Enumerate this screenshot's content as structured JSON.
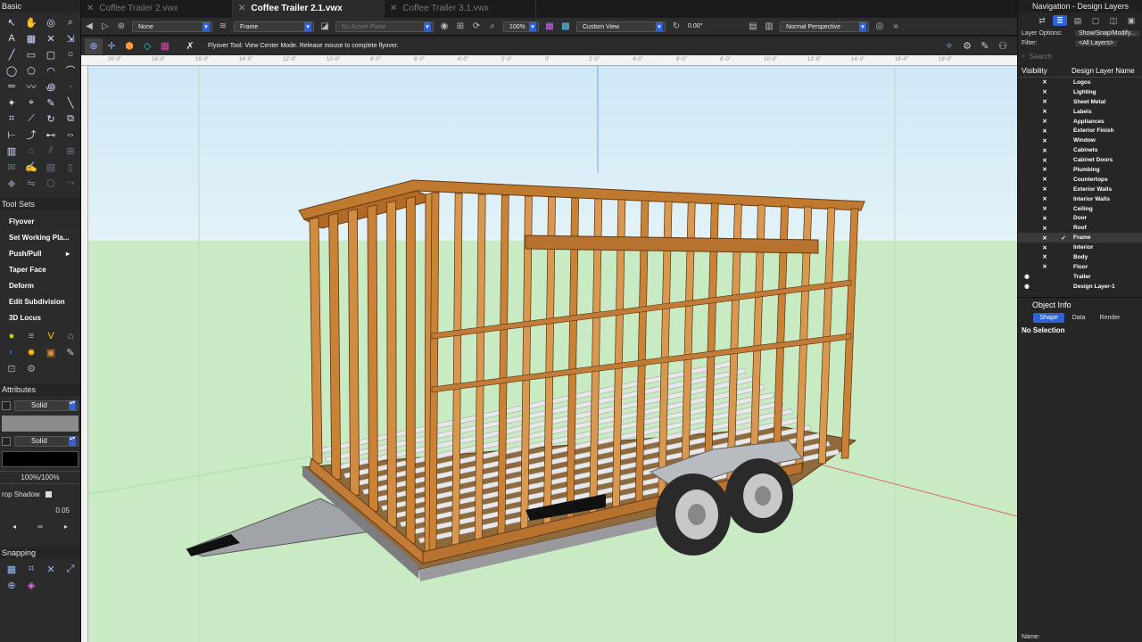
{
  "left_palette": {
    "basic_title": "Basic",
    "basic_tools": [
      "arrow-cursor",
      "pan-hand",
      "flyover-eye",
      "zoom",
      "text",
      "selection",
      "crop",
      "marker",
      "line",
      "rectangle",
      "rounded-rect",
      "ellipse",
      "circle",
      "polygon",
      "arc",
      "polyline",
      "double-line",
      "freehand",
      "spiral",
      "3d-point",
      "magic-wand",
      "eyedropper",
      "brush",
      "segment",
      "smart-cursor",
      "connector",
      "rotate",
      "offset",
      "dim",
      "path",
      "chain-dim",
      "tape",
      "wall",
      "roof",
      "stair",
      "window",
      "callout",
      "note",
      "sheet",
      "label",
      "paint",
      "mirror",
      "extrude",
      "sweep"
    ],
    "toolsets_title": "Tool Sets",
    "toolsets": [
      {
        "label": "Flyover",
        "selected": true
      },
      {
        "label": "Set Working Pla...",
        "arrow": true
      },
      {
        "label": "Push/Pull"
      },
      {
        "label": "Taper Face"
      },
      {
        "label": "Deform"
      },
      {
        "label": "Edit Subdivision"
      },
      {
        "label": "3D Locus"
      }
    ],
    "attributes_title": "Attributes",
    "fill_label": "Solid",
    "pen_label": "Solid",
    "opacity_label": "100%/100%",
    "drop_shadow_label": "rop Shadow",
    "line_weight": "0.05",
    "snapping_title": "Snapping"
  },
  "tabs": [
    {
      "label": "Coffee Trailer 2.vwx",
      "active": false
    },
    {
      "label": "Coffee Trailer 2.1.vwx",
      "active": true
    },
    {
      "label": "Coffee Trailer 3.1.vwx",
      "active": false
    }
  ],
  "viewbar": {
    "class_drop": "None",
    "layer_drop": "Frame",
    "plane_drop": "No Active Plane",
    "zoom": "100%",
    "view_drop": "Custom View",
    "angle": "0.00°",
    "projection": "Normal Perspective"
  },
  "modebar": {
    "message": "Flyover Tool: View Center Mode. Release mouse to complete flyover."
  },
  "ruler": {
    "ticks": [
      "20'-0\"",
      "18'-0\"",
      "16'-0\"",
      "14'-0\"",
      "12'-0\"",
      "10'-0\"",
      "8'-0\"",
      "6'-0\"",
      "4'-0\"",
      "2'-0\"",
      "0\"",
      "2'-0\"",
      "4'-0\"",
      "6'-0\"",
      "8'-0\"",
      "10'-0\"",
      "12'-0\"",
      "14'-0\"",
      "16'-0\"",
      "18'-0\""
    ]
  },
  "right_panel": {
    "title": "Navigation - Design Layers",
    "layer_options_label": "Layer Options:",
    "layer_options_value": "Show/Snap/Modify...",
    "filter_label": "Filter:",
    "filter_value": "<All Layers>",
    "search_placeholder": "Search",
    "col_visibility": "Visibility",
    "col_name": "Design Layer Name",
    "layers": [
      {
        "name": "Logos",
        "vis": "x",
        "active": false
      },
      {
        "name": "Lighting",
        "vis": "x",
        "active": false
      },
      {
        "name": "Sheet Metal",
        "vis": "x",
        "active": false
      },
      {
        "name": "Labels",
        "vis": "x",
        "active": false
      },
      {
        "name": "Appliances",
        "vis": "x",
        "active": false
      },
      {
        "name": "Exterior Finish",
        "vis": "x",
        "active": false
      },
      {
        "name": "Window",
        "vis": "x",
        "active": false
      },
      {
        "name": "Cabinets",
        "vis": "x",
        "active": false
      },
      {
        "name": "Cabinet Doors",
        "vis": "x",
        "active": false
      },
      {
        "name": "Plumbing",
        "vis": "x",
        "active": false
      },
      {
        "name": "Countertops",
        "vis": "x",
        "active": false
      },
      {
        "name": "Exterior Walls",
        "vis": "x",
        "active": false
      },
      {
        "name": "Interior Walls",
        "vis": "x",
        "active": false
      },
      {
        "name": "Ceiling",
        "vis": "x",
        "active": false
      },
      {
        "name": "Door",
        "vis": "x",
        "active": false
      },
      {
        "name": "Roof",
        "vis": "x",
        "active": false
      },
      {
        "name": "Frame",
        "vis": "x",
        "active": true
      },
      {
        "name": "Interior",
        "vis": "x",
        "active": false
      },
      {
        "name": "Body",
        "vis": "x",
        "active": false
      },
      {
        "name": "Floor",
        "vis": "x",
        "active": false
      },
      {
        "name": "Trailer",
        "vis": "eye",
        "active": false
      },
      {
        "name": "Design Layer-1",
        "vis": "eye",
        "active": false
      }
    ],
    "object_info_title": "Object Info",
    "oi_tabs": [
      "Shape",
      "Data",
      "Render"
    ],
    "no_selection": "No Selection",
    "name_label": "Name:"
  }
}
